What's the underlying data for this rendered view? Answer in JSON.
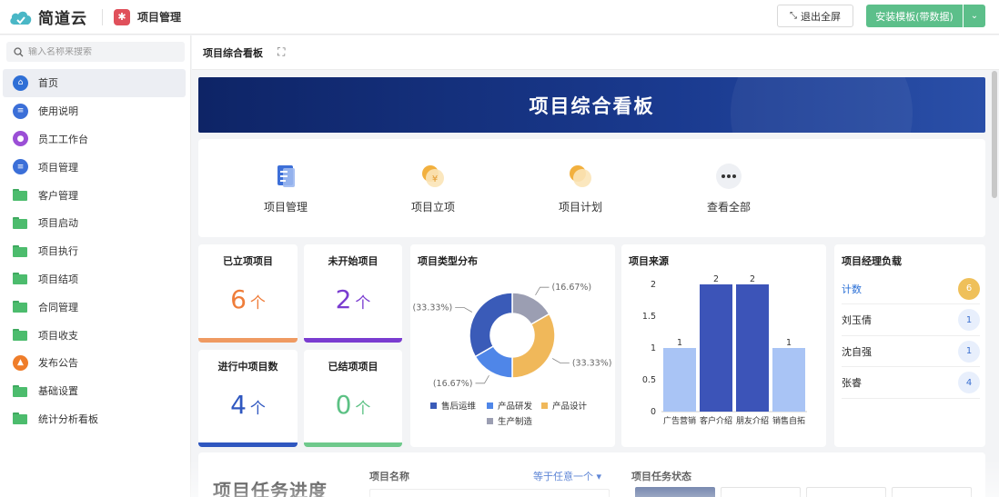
{
  "topbar": {
    "brand": "简道云",
    "app_name": "项目管理",
    "exit_fullscreen": "退出全屏",
    "install_template": "安装模板(带数据)"
  },
  "sidebar": {
    "search_placeholder": "输入名称来搜索",
    "items": [
      {
        "label": "首页",
        "icon": "home-icon",
        "color": "#2f6fd6"
      },
      {
        "label": "使用说明",
        "icon": "doc-icon",
        "color": "#3b6fd8"
      },
      {
        "label": "员工工作台",
        "icon": "user-icon",
        "color": "#9b4fd6"
      },
      {
        "label": "项目管理",
        "icon": "doc-icon",
        "color": "#3b6fd8"
      },
      {
        "label": "客户管理",
        "icon": "folder-icon",
        "color": "#4cbc6d"
      },
      {
        "label": "项目启动",
        "icon": "folder-icon",
        "color": "#4cbc6d"
      },
      {
        "label": "项目执行",
        "icon": "folder-icon",
        "color": "#4cbc6d"
      },
      {
        "label": "项目结项",
        "icon": "folder-icon",
        "color": "#4cbc6d"
      },
      {
        "label": "合同管理",
        "icon": "folder-icon",
        "color": "#4cbc6d"
      },
      {
        "label": "项目收支",
        "icon": "folder-icon",
        "color": "#4cbc6d"
      },
      {
        "label": "发布公告",
        "icon": "person-icon",
        "color": "#ef7d2a"
      },
      {
        "label": "基础设置",
        "icon": "folder-icon",
        "color": "#4cbc6d"
      },
      {
        "label": "统计分析看板",
        "icon": "folder-icon",
        "color": "#4cbc6d"
      }
    ]
  },
  "content": {
    "tab": "项目综合看板",
    "banner_title": "项目综合看板"
  },
  "quick_links": [
    {
      "label": "项目管理",
      "icon": "bookmark-doc-icon"
    },
    {
      "label": "项目立项",
      "icon": "coin-icon"
    },
    {
      "label": "项目计划",
      "icon": "coin-icon"
    },
    {
      "label": "查看全部",
      "icon": "more-icon"
    }
  ],
  "stats": [
    {
      "title": "已立项项目",
      "value": "6",
      "unit": "个",
      "color": "#ef7d3a"
    },
    {
      "title": "未开始项目",
      "value": "2",
      "unit": "个",
      "color": "#7a3cd0"
    },
    {
      "title": "进行中项目数",
      "value": "4",
      "unit": "个",
      "color": "#2f57c0"
    },
    {
      "title": "已结项项目",
      "value": "0",
      "unit": "个",
      "color": "#5cc184"
    }
  ],
  "chart_data": [
    {
      "type": "pie",
      "title": "项目类型分布",
      "donut": true,
      "categories": [
        "售后运维",
        "产品研发",
        "产品设计",
        "生产制造"
      ],
      "percent_labels": [
        "(33.33%)",
        "(16.67%)",
        "(33.33%)",
        "(16.67%)"
      ],
      "values": [
        33.33,
        16.67,
        33.33,
        16.67
      ],
      "colors": [
        "#3a5bb8",
        "#4f86e8",
        "#f0b85a",
        "#9b9eb2"
      ],
      "legend": "bottom"
    },
    {
      "type": "bar",
      "title": "项目来源",
      "categories": [
        "广告营销",
        "客户介绍",
        "朋友介绍",
        "销售自拓"
      ],
      "values": [
        1,
        2,
        2,
        1
      ],
      "value_labels": [
        "1",
        "2",
        "2",
        "1"
      ],
      "colors": [
        "#a9c4f5",
        "#3c54b8",
        "#3c54b8",
        "#a9c4f5"
      ],
      "ylim": [
        0,
        2
      ],
      "yticks": [
        "0",
        "0.5",
        "1",
        "1.5",
        "2"
      ],
      "yticks_values": [
        0,
        0.5,
        1,
        1.5,
        2
      ]
    }
  ],
  "managers": {
    "title": "项目经理负载",
    "rows": [
      {
        "name": "计数",
        "count": "6",
        "highlight": true
      },
      {
        "name": "刘玉倩",
        "count": "1"
      },
      {
        "name": "沈自强",
        "count": "1"
      },
      {
        "name": "张睿",
        "count": "4"
      }
    ]
  },
  "bottom": {
    "title": "项目任务进度",
    "name_label": "项目名称",
    "filter": "等于任意一个",
    "status_label": "项目任务状态"
  }
}
